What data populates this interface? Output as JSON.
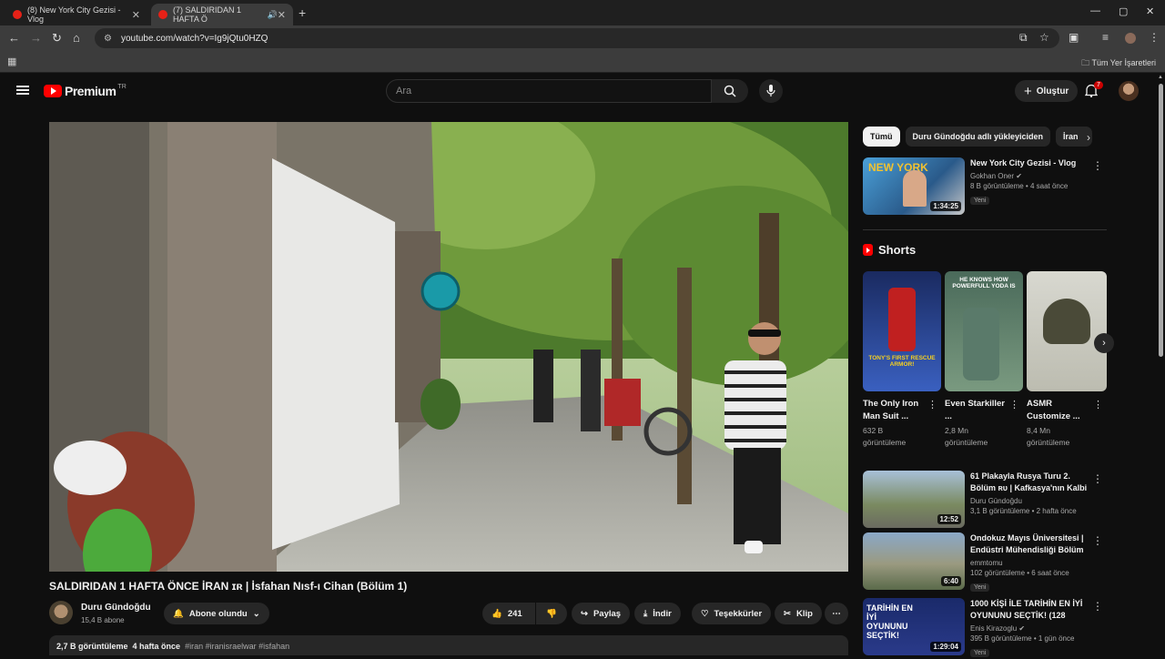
{
  "browser": {
    "tabs": [
      {
        "title": "(8) New York City Gezisi - Vlog",
        "close": "✕"
      },
      {
        "title": "(7) SALDIRIDAN 1 HAFTA Ö",
        "close": "✕"
      }
    ],
    "new_tab": "+",
    "window_controls": {
      "minimize": "—",
      "maximize": "▢",
      "close": "✕"
    },
    "nav": {
      "back": "←",
      "forward": "→",
      "reload": "↻",
      "home": "⌂"
    },
    "url": "youtube.com/watch?v=Ig9jQtu0HZQ",
    "bookmarks_all": "Tüm Yer İşaretleri"
  },
  "youtube": {
    "logo_word": "Premium",
    "logo_country": "TR",
    "search_placeholder": "Ara",
    "create_label": "Oluştur",
    "notif_count": "7"
  },
  "video": {
    "title": "SALDIRIDAN 1 HAFTA ÖNCE İRAN ɪʀ | İsfahan Nısf-ı Cihan (Bölüm 1)",
    "channel": "Duru Gündoğdu",
    "subscribers": "15,4 B abone",
    "subscribe_label": "Abone olundu",
    "likes": "241",
    "share": "Paylaş",
    "download": "İndir",
    "thanks": "Teşekkürler",
    "clip": "Klip",
    "more": "⋯",
    "views": "2,7 B görüntüleme",
    "age": "4 hafta önce",
    "tags": "#iran #iranisraelwar #isfahan"
  },
  "chips": [
    "Tümü",
    "Duru Gündoğdu adlı yükleyiciden",
    "İran"
  ],
  "recommendations_top": [
    {
      "title": "New York City Gezisi - Vlog",
      "channel": "Gokhan Oner",
      "views": "8 B görüntüleme • 4 saat önce",
      "duration": "1:34:25",
      "badge": "Yeni",
      "thumb_text": "NEW YORK"
    }
  ],
  "shorts": {
    "heading": "Shorts",
    "items": [
      {
        "title": "The Only Iron Man Suit ...",
        "views": "632 B görüntüleme",
        "caption": "TONY'S FIRST RESCUE ARMOR!"
      },
      {
        "title": "Even Starkiller ...",
        "views": "2,8 Mn görüntüleme",
        "caption": "HE KNOWS HOW POWERFULL YODA IS"
      },
      {
        "title": "ASMR Customize ...",
        "views": "8,4 Mn görüntüleme",
        "caption": ""
      }
    ]
  },
  "recommendations": [
    {
      "title": "61 Plakayla Rusya Turu 2. Bölüm ʀᴜ | Kafkasya'nın Kalbi ...",
      "channel": "Duru Gündoğdu",
      "views": "3,1 B görüntüleme • 2 hafta önce",
      "duration": "12:52",
      "badge": ""
    },
    {
      "title": "Ondokuz Mayıs Üniversitesi | Endüstri Mühendisliği Bölüm ...",
      "channel": "emmtomu",
      "views": "102 görüntüleme • 6 saat önce",
      "duration": "6:40",
      "badge": "Yeni"
    },
    {
      "title": "1000 KİŞİ İLE TARİHİN EN İYİ OYUNUNU SEÇTİK! (128 OYUN...",
      "channel": "Enis Kirazoglu",
      "views": "395 B görüntüleme • 1 gün önce",
      "duration": "1:29:04",
      "badge": "Yeni",
      "thumb_text": "TARİHİN EN İYİ OYUNUNU SEÇTİK!"
    }
  ],
  "colors": {
    "accent": "#ff0000",
    "bg": "#0f0f0f",
    "surface": "#272727"
  }
}
